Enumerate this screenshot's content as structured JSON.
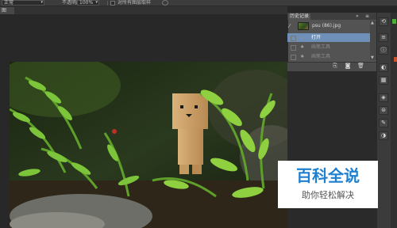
{
  "options_bar": {
    "mode_value": "正常",
    "opacity_label": "不透明度:",
    "opacity_value": "100%",
    "sample_label": "对所有图层取样"
  },
  "document_tab": {
    "label": "图"
  },
  "history_panel": {
    "tab_label": "历史记录",
    "collapse_icon": "double-chevron-right-icon",
    "menu_icon": "panel-menu-icon",
    "snapshot_label": "psu (86).jpg",
    "rows": [
      {
        "label": "打开",
        "selected": true
      },
      {
        "label": "画笔工具",
        "selected": false
      },
      {
        "label": "画笔工具",
        "selected": false
      }
    ],
    "footer_icons": [
      "new-document-from-state-icon",
      "camera-snapshot-icon",
      "trash-icon"
    ]
  },
  "icon_strip": {
    "tools": [
      "history-icon",
      "properties-icon",
      "info-icon",
      "color-icon",
      "swatches-icon",
      "layers-icon",
      "channels-icon",
      "paths-icon",
      "adjustments-icon"
    ]
  },
  "watermark": {
    "title": "百科全说",
    "subtitle": "助你轻松解决"
  },
  "colors": {
    "panel_bg": "#535353",
    "selection": "#6e8fb8",
    "watermark_blue": "#1f7fd0"
  }
}
